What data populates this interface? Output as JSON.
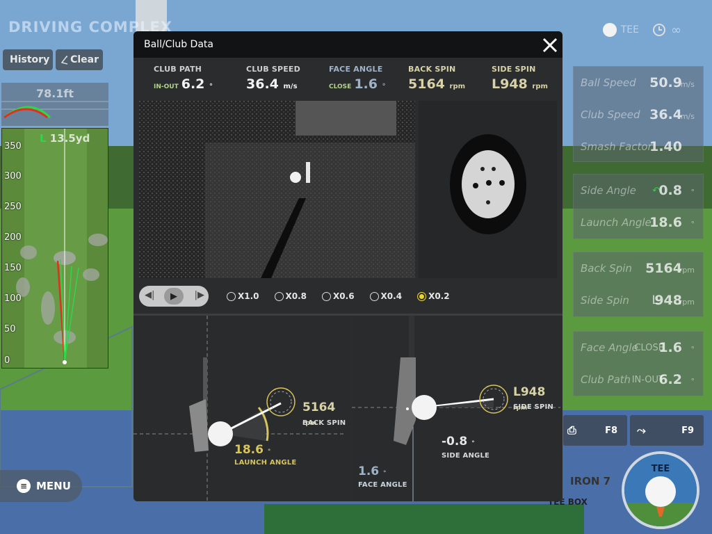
{
  "app": {
    "title": "DRIVING COMPLEX",
    "history_label": "History",
    "clear_label": "Clear",
    "ball_label": "TEE",
    "infinity": "∞"
  },
  "left_map": {
    "carry": "78.1ft",
    "lateral_prefix": "L",
    "lateral": "13.5yd",
    "ticks": [
      "350",
      "300",
      "250",
      "200",
      "150",
      "100",
      "50",
      "0"
    ]
  },
  "stats": [
    {
      "label": "Ball Speed",
      "value": "50.9",
      "unit": "m/s"
    },
    {
      "label": "Club Speed",
      "value": "36.4",
      "unit": "m/s"
    },
    {
      "label": "Smash Factor",
      "value": "1.40",
      "unit": ""
    },
    {
      "label": "Side Angle",
      "value": "0.8",
      "unit": "°"
    },
    {
      "label": "Launch Angle",
      "value": "18.6",
      "unit": "°"
    },
    {
      "label": "Back Spin",
      "value": "5164",
      "unit": "rpm"
    },
    {
      "label": "Side Spin",
      "prefix": "L",
      "value": "948",
      "unit": "rpm"
    },
    {
      "label": "Face Angle",
      "dir": "CLOSE",
      "value": "1.6",
      "unit": "°"
    },
    {
      "label": "Club Path",
      "dir": "IN-OUT",
      "value": "6.2",
      "unit": "°"
    }
  ],
  "bottom": {
    "menu_label": "MENU",
    "f8": "F8",
    "f9": "F9",
    "club": "IRON 7",
    "teebox": "TEE BOX",
    "tee_button": "TEE"
  },
  "modal": {
    "title": "Ball/Club Data",
    "metrics": [
      {
        "label": "CLUB PATH",
        "dir": "IN-OUT",
        "value": "6.2",
        "unit": "°"
      },
      {
        "label": "CLUB SPEED",
        "value": "36.4",
        "unit": "m/s"
      },
      {
        "label": "FACE ANGLE",
        "dir": "CLOSE",
        "value": "1.6",
        "unit": "°"
      },
      {
        "label": "BACK SPIN",
        "value": "5164",
        "unit": "rpm"
      },
      {
        "label": "SIDE SPIN",
        "value": "L948",
        "unit": "rpm"
      }
    ],
    "speeds": [
      "X1.0",
      "X0.8",
      "X0.6",
      "X0.4",
      "X0.2"
    ],
    "selected_speed": "X0.2",
    "launch": {
      "back_spin": "5164",
      "back_spin_unit": "rpm",
      "back_spin_label": "BACK SPIN",
      "launch_angle": "18.6",
      "launch_unit": "°",
      "launch_label": "LAUNCH ANGLE"
    },
    "side": {
      "side_spin": "L948",
      "side_spin_unit": "rpm",
      "side_spin_label": "SIDE SPIN",
      "side_angle": "-0.8",
      "side_unit": "°",
      "side_label": "SIDE ANGLE",
      "face_angle": "1.6",
      "face_unit": "°",
      "face_label": "FACE ANGLE"
    }
  },
  "colors": {
    "accent": "#e8d42a",
    "launch": "#d6c45c",
    "face": "#9fb3c8",
    "trace_red": "#e0301e",
    "trace_green": "#2fd64a"
  }
}
